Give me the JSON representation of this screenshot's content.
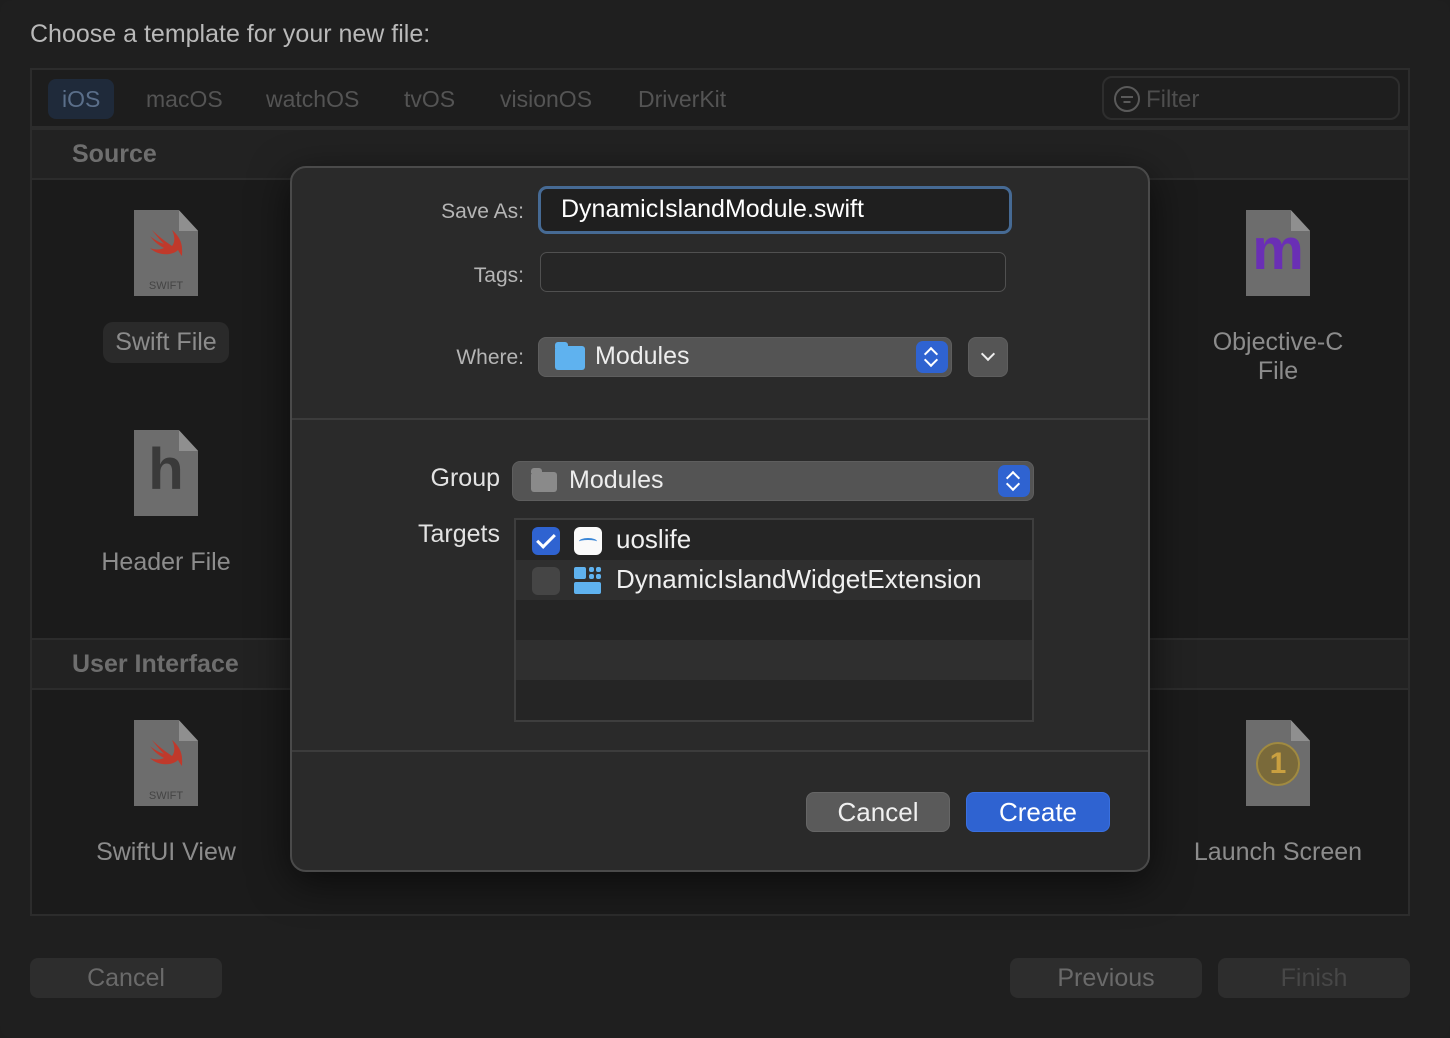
{
  "header": {
    "title": "Choose a template for your new file:"
  },
  "platform_tabs": [
    "iOS",
    "macOS",
    "watchOS",
    "tvOS",
    "visionOS",
    "DriverKit"
  ],
  "filter": {
    "placeholder": "Filter"
  },
  "sections": {
    "source": {
      "title": "Source"
    },
    "user_interface": {
      "title": "User Interface"
    }
  },
  "templates": {
    "swift_file": {
      "label": "Swift File",
      "icon": "swift-doc-icon",
      "caption": "SWIFT"
    },
    "objc_file": {
      "label": "Objective-C File",
      "icon": "m-doc-icon",
      "glyph": "m"
    },
    "header_file": {
      "label": "Header File",
      "icon": "h-doc-icon",
      "glyph": "h"
    },
    "swiftui_view": {
      "label": "SwiftUI View",
      "icon": "swift-doc-icon",
      "caption": "SWIFT"
    },
    "launch_screen": {
      "label": "Launch Screen",
      "icon": "storyboard-doc-icon",
      "glyph": "1"
    }
  },
  "bottom_bar": {
    "cancel": "Cancel",
    "previous": "Previous",
    "finish": "Finish"
  },
  "save_sheet": {
    "save_as_label": "Save As:",
    "save_as_value": "DynamicIslandModule.swift",
    "tags_label": "Tags:",
    "tags_value": "",
    "where_label": "Where:",
    "where_value": "Modules",
    "group_label": "Group",
    "group_value": "Modules",
    "targets_label": "Targets",
    "targets": [
      {
        "name": "uoslife",
        "checked": true,
        "icon": "app-icon"
      },
      {
        "name": "DynamicIslandWidgetExtension",
        "checked": false,
        "icon": "widget-extension-icon"
      }
    ],
    "cancel": "Cancel",
    "create": "Create"
  },
  "colors": {
    "accent": "#2f63d1",
    "folder": "#5fb2ef",
    "focus_ring": "#466a94"
  }
}
